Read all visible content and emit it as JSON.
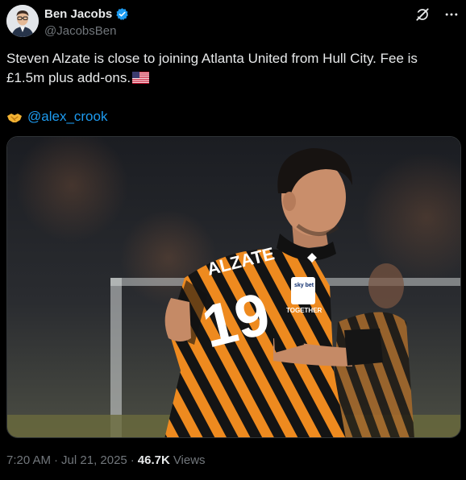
{
  "author": {
    "display_name": "Ben Jacobs",
    "handle": "@JacobsBen",
    "verified": true
  },
  "tweet": {
    "text": "Steven Alzate is close to joining Atlanta United from Hull City. Fee is £1.5m plus add-ons.",
    "mention": "@alex_crook",
    "time": "7:20 AM",
    "date": "Jul 21, 2025",
    "views_count": "46.7K",
    "views_label": "Views"
  },
  "media": {
    "shirt_name": "ALZATE",
    "shirt_number": "19",
    "sponsor": "sky bet",
    "chest_text": "TOGETHER"
  },
  "icons": {
    "verified": "verified-badge-icon",
    "grok": "grok-icon",
    "more": "more-options-icon",
    "handshake": "handshake-emoji-icon",
    "flag": "us-flag-emoji-icon"
  },
  "colors": {
    "background": "#000000",
    "text": "#e7e9ea",
    "muted": "#71767b",
    "link": "#1d9bf0",
    "verified": "#1d9bf0",
    "kit_amber": "#f08a1c",
    "kit_black": "#111111"
  }
}
